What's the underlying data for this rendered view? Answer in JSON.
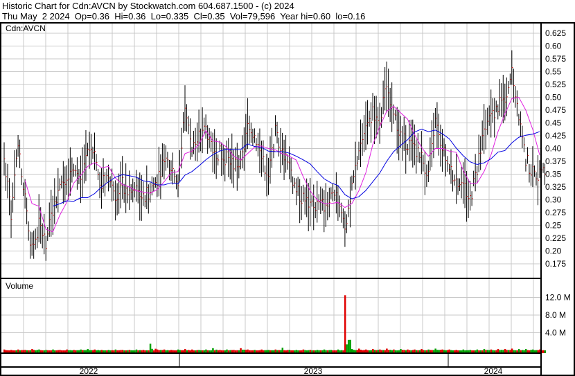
{
  "header": {
    "title": "Historic Chart for Cdn:AVCN by Stockwatch.com 604.687.1500 - (c) 2024",
    "quote": "Thu May  2 2024  Op=0.36  Hi=0.36  Lo=0.335  Cl=0.35  Vol=79,596  Year hi=0.60  lo=0.16"
  },
  "chart_data": {
    "type": "bar",
    "title": "Cdn:AVCN",
    "price_ticks": [
      "0.625",
      "0.60",
      "0.575",
      "0.55",
      "0.525",
      "0.50",
      "0.475",
      "0.45",
      "0.425",
      "0.40",
      "0.375",
      "0.35",
      "0.325",
      "0.30",
      "0.275",
      "0.25",
      "0.225",
      "0.20",
      "0.175"
    ],
    "ylim": [
      0.145,
      0.645
    ],
    "volume_label": "Volume",
    "volume_ticks": [
      "12.0 M",
      "8.0 M",
      "4.0 M"
    ],
    "volume_ylim_millions": [
      0,
      15.5
    ],
    "x_labels": [
      "2022",
      "2023",
      "2024"
    ],
    "close": [
      0.38,
      0.27,
      0.4,
      0.3,
      0.2,
      0.25,
      0.22,
      0.28,
      0.33,
      0.35,
      0.37,
      0.34,
      0.4,
      0.38,
      0.33,
      0.35,
      0.31,
      0.33,
      0.31,
      0.32,
      0.3,
      0.32,
      0.34,
      0.38,
      0.37,
      0.33,
      0.48,
      0.4,
      0.42,
      0.44,
      0.4,
      0.39,
      0.38,
      0.37,
      0.37,
      0.44,
      0.43,
      0.38,
      0.35,
      0.43,
      0.4,
      0.36,
      0.32,
      0.3,
      0.29,
      0.29,
      0.29,
      0.3,
      0.3,
      0.25,
      0.32,
      0.4,
      0.44,
      0.47,
      0.46,
      0.52,
      0.48,
      0.42,
      0.41,
      0.4,
      0.38,
      0.35,
      0.47,
      0.4,
      0.36,
      0.34,
      0.33,
      0.3,
      0.36,
      0.43,
      0.46,
      0.48,
      0.5,
      0.55,
      0.47,
      0.38,
      0.35,
      0.35
    ],
    "volume_millions": [
      0.2,
      0.1,
      0.2,
      0.1,
      0.3,
      0.2,
      0.1,
      0.2,
      0.1,
      0.2,
      0.1,
      0.2,
      0.3,
      0.2,
      0.1,
      0.1,
      0.2,
      0.1,
      0.1,
      0.2,
      0.1,
      1.5,
      0.2,
      0.2,
      0.1,
      0.2,
      0.3,
      0.2,
      0.1,
      0.2,
      0.5,
      0.1,
      0.2,
      0.1,
      0.5,
      0.2,
      0.1,
      0.2,
      0.1,
      0.2,
      0.6,
      0.1,
      0.1,
      0.2,
      0.1,
      0.1,
      0.2,
      0.1,
      0.2,
      12.5,
      0.3,
      0.4,
      0.2,
      0.3,
      0.2,
      0.4,
      0.2,
      0.3,
      0.2,
      0.2,
      0.3,
      0.2,
      0.4,
      0.2,
      0.2,
      0.1,
      0.2,
      0.1,
      0.2,
      0.3,
      0.2,
      0.3,
      0.3,
      0.4,
      0.3,
      0.3,
      0.2,
      0.2
    ],
    "series_colors": {
      "bars": "#000000",
      "ma_short": "#e020e0",
      "ma_long": "#0000e0",
      "vol_up": "#00a000",
      "vol_down": "#e00000"
    }
  }
}
